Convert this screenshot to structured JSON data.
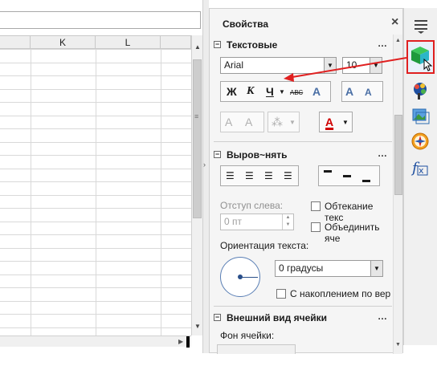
{
  "sheet": {
    "columns": [
      "K",
      "L"
    ]
  },
  "panel": {
    "title": "Свойства",
    "close_glyph": "×",
    "text_section": {
      "title": "Текстовые",
      "font_name": "Arial",
      "font_size": "10",
      "bold": "Ж",
      "italic": "К",
      "underline": "Ч",
      "strike": "АВС"
    },
    "align_section": {
      "title": "Выров~нять",
      "indent_label": "Отступ слева:",
      "indent_value": "0 пт",
      "wrap_text": "Обтекание текс",
      "merge_cells": "Объединить яче",
      "orientation_label": "Ориентация текста:",
      "rotation_value": "0 градусы",
      "stacked": "С накоплением по вер"
    },
    "appearance_section": {
      "title": "Внешний вид ячейки",
      "bg_label": "Фон ячейки:"
    }
  },
  "colors": {
    "annotation_red": "#e02020",
    "font_color_red": "#d00000"
  }
}
